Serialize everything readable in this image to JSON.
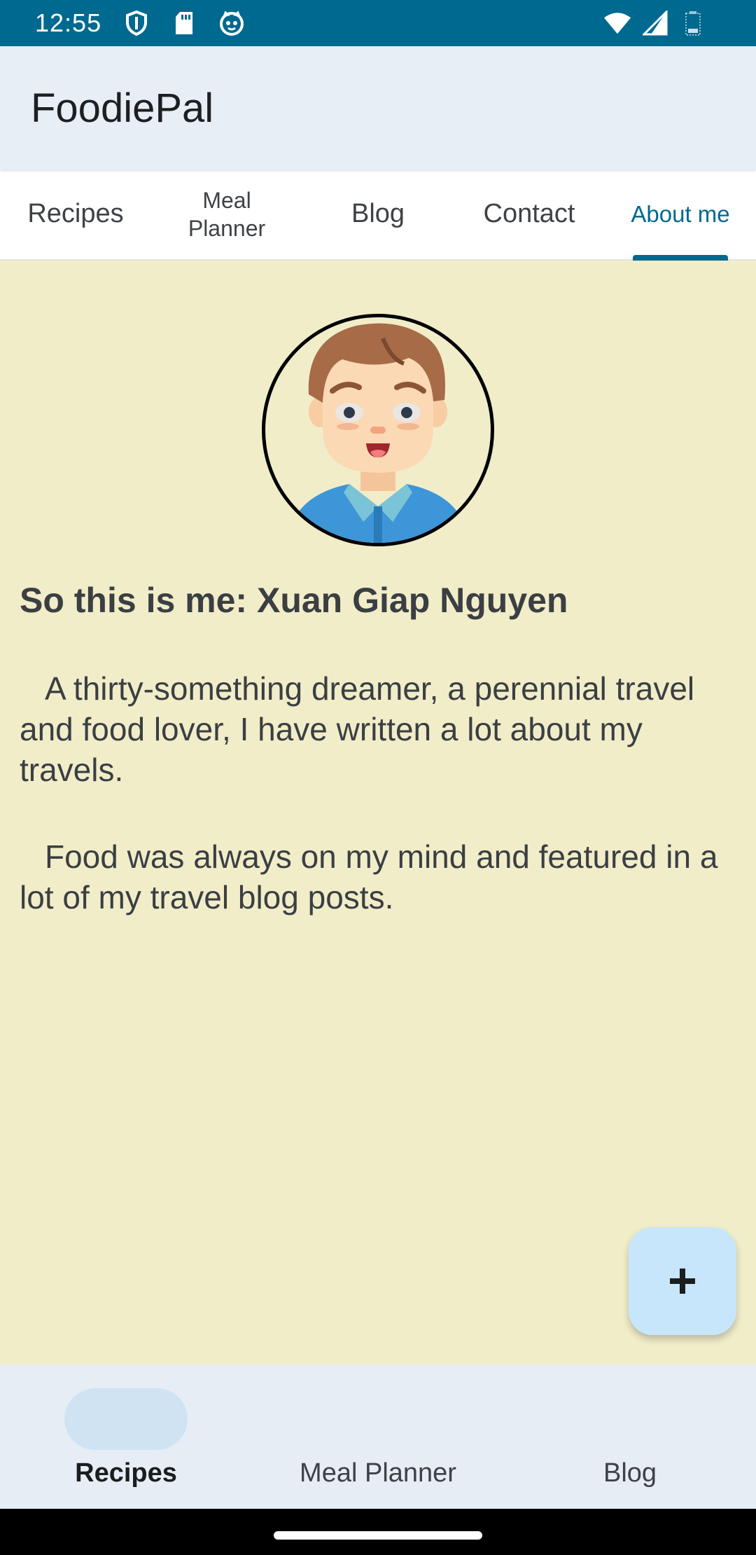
{
  "status_bar": {
    "time": "12:55",
    "left_icons": [
      "shield-icon",
      "sd-card-icon",
      "cat-face-icon"
    ],
    "right_icons": [
      "wifi-icon",
      "signal-icon",
      "battery-icon"
    ]
  },
  "app_bar": {
    "title": "FoodiePal"
  },
  "tabs": [
    {
      "label": "Recipes",
      "active": false
    },
    {
      "label": "Meal Planner",
      "active": false
    },
    {
      "label": "Blog",
      "active": false
    },
    {
      "label": "Contact",
      "active": false
    },
    {
      "label": "About me",
      "active": true
    }
  ],
  "about": {
    "heading": "So this is me: Xuan Giap Nguyen",
    "paragraph1": "A thirty-something dreamer, a perennial travel and food lover, I have written a lot about my travels.",
    "paragraph2": "Food was always on my mind and featured in a lot of my travel blog posts."
  },
  "fab": {
    "icon": "plus-icon",
    "label": "+"
  },
  "bottom_nav": [
    {
      "label": "Recipes",
      "active": true
    },
    {
      "label": "Meal Planner",
      "active": false
    },
    {
      "label": "Blog",
      "active": false
    }
  ],
  "colors": {
    "primary": "#00698f",
    "content_bg": "#f1edc9",
    "app_bar_bg": "#e8eef5",
    "fab_bg": "#c8e6fb"
  }
}
